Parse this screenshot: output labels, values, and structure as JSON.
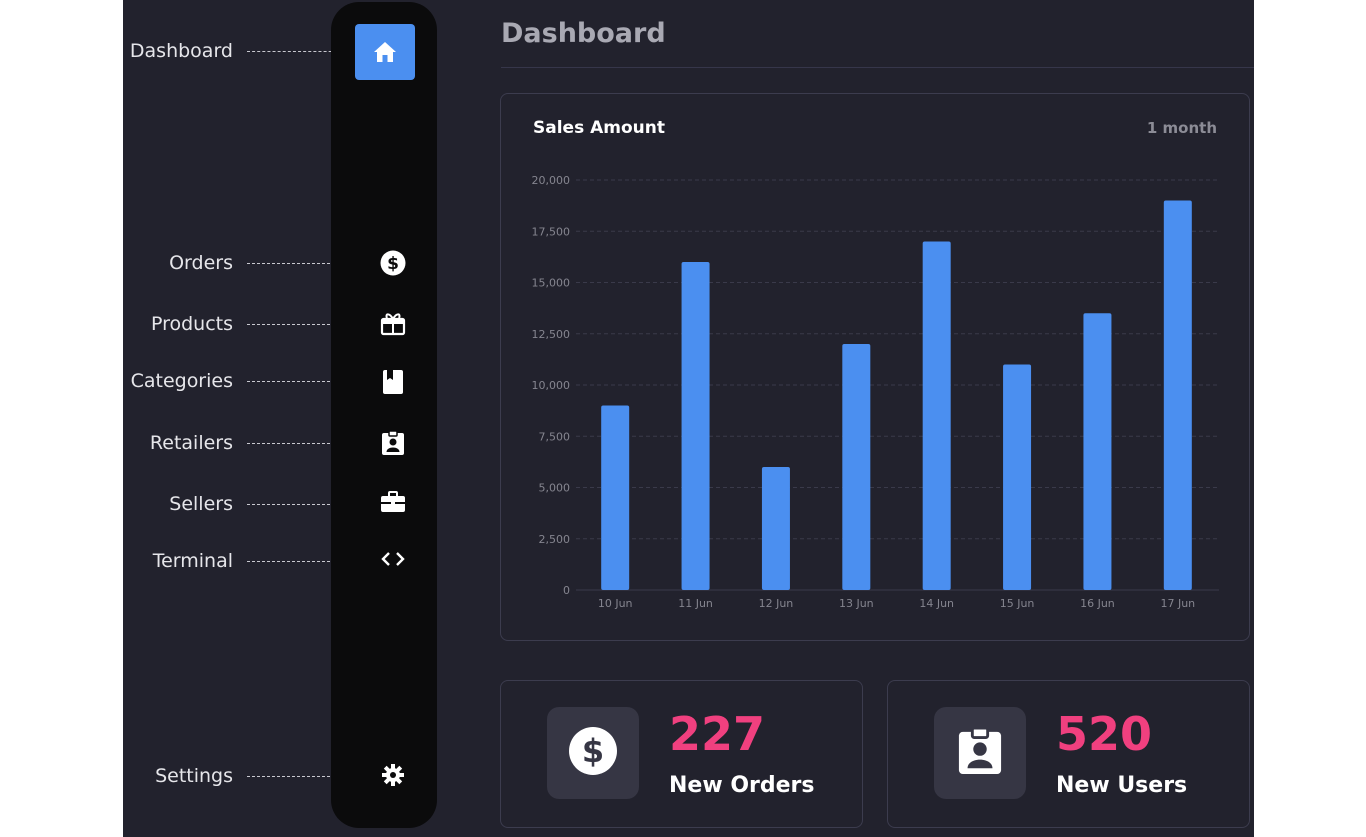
{
  "annotations": [
    {
      "label": "Dashboard",
      "icon": "home-icon"
    },
    {
      "label": "Orders",
      "icon": "dollar-icon"
    },
    {
      "label": "Products",
      "icon": "gift-icon"
    },
    {
      "label": "Categories",
      "icon": "bookmark-book-icon"
    },
    {
      "label": "Retailers",
      "icon": "id-badge-icon"
    },
    {
      "label": "Sellers",
      "icon": "briefcase-icon"
    },
    {
      "label": "Terminal",
      "icon": "code-icon"
    },
    {
      "label": "Settings",
      "icon": "gear-icon"
    }
  ],
  "header": {
    "title": "Dashboard"
  },
  "chart_card": {
    "title": "Sales Amount",
    "range": "1 month"
  },
  "chart_data": {
    "type": "bar",
    "title": "Sales Amount",
    "xlabel": "",
    "ylabel": "",
    "categories": [
      "10 Jun",
      "11 Jun",
      "12 Jun",
      "13 Jun",
      "14 Jun",
      "15 Jun",
      "16 Jun",
      "17 Jun"
    ],
    "values": [
      9000,
      16000,
      6000,
      12000,
      17000,
      11000,
      13500,
      19000
    ],
    "ylim": [
      0,
      20000
    ],
    "yticks": [
      "0",
      "2,500",
      "5,000",
      "7,500",
      "10,000",
      "12,500",
      "15,000",
      "17,500",
      "20,000"
    ],
    "grid": true,
    "bar_color": "#4b8ff0"
  },
  "stats": [
    {
      "value": "227",
      "label": "New Orders",
      "icon": "dollar-icon"
    },
    {
      "value": "520",
      "label": "New Users",
      "icon": "id-badge-icon"
    }
  ],
  "colors": {
    "accent": "#4b8ff0",
    "stat_value": "#f0407f",
    "background": "#22222d",
    "sidebar": "#0b0b0c"
  }
}
